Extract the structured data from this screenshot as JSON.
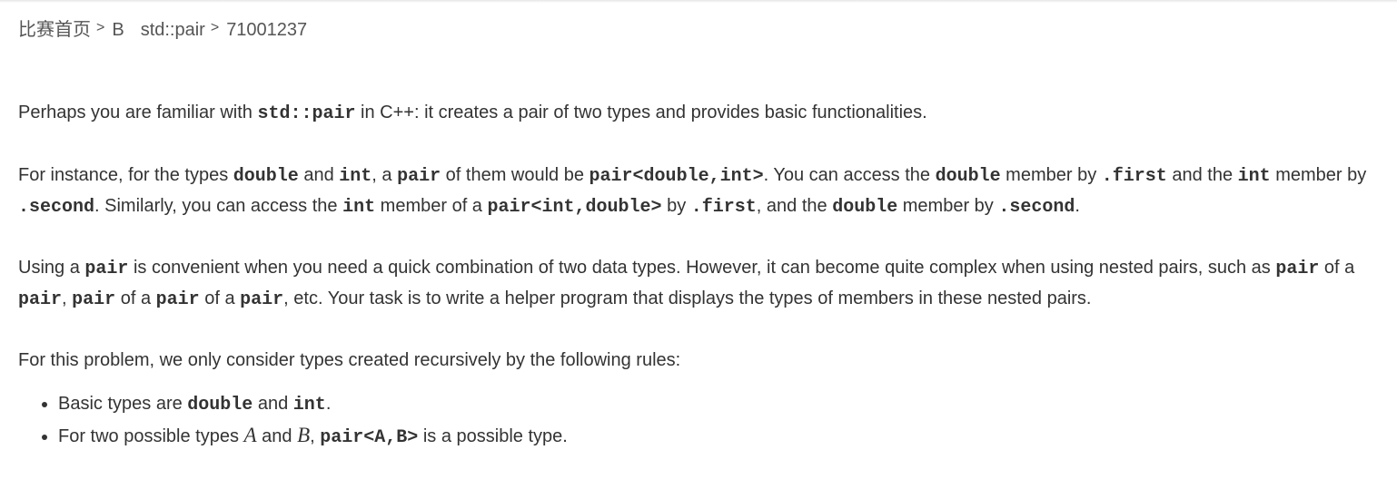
{
  "breadcrumb": {
    "home": "比赛首页",
    "sep": ">",
    "problem_letter": "B",
    "problem_name": "std::pair",
    "submission_id": "71001237"
  },
  "statement": {
    "p1": {
      "t1": "Perhaps you are familiar with ",
      "c1": "std::pair",
      "t2": " in C++: it creates a pair of two types and provides basic functionalities."
    },
    "p2": {
      "t1": "For instance, for the types ",
      "c1": "double",
      "t2": " and ",
      "c2": "int",
      "t3": ", a ",
      "c3": "pair",
      "t4": " of them would be ",
      "c4": "pair<double,int>",
      "t5": ". You can access the ",
      "c5": "double",
      "t6": " member by ",
      "c6": ".first",
      "t7": " and the ",
      "c7": "int",
      "t8": " member by ",
      "c8": ".second",
      "t9": ". Similarly, you can access the ",
      "c9": "int",
      "t10": " member of a ",
      "c10": "pair<int,double>",
      "t11": " by ",
      "c11": ".first",
      "t12": ", and the ",
      "c12": "double",
      "t13": " member by ",
      "c13": ".second",
      "t14": "."
    },
    "p3": {
      "t1": "Using a ",
      "c1": "pair",
      "t2": " is convenient when you need a quick combination of two data types. However, it can become quite complex when using nested pairs, such as ",
      "c2": "pair",
      "t3": " of a ",
      "c3": "pair",
      "t4": ", ",
      "c4": "pair",
      "t5": " of a ",
      "c5": "pair",
      "t6": " of a ",
      "c6": "pair",
      "t7": ", etc. Your task is to write a helper program that displays the types of members in these nested pairs."
    },
    "p4": "For this problem, we only consider types created recursively by the following rules:",
    "rules": {
      "r1": {
        "t1": "Basic types are ",
        "c1": "double",
        "t2": " and ",
        "c2": "int",
        "t3": "."
      },
      "r2": {
        "t1": "For two possible types ",
        "m1": "A",
        "t2": " and ",
        "m2": "B",
        "t3": ", ",
        "c1": "pair<A,B>",
        "t4": " is a possible type."
      }
    }
  }
}
